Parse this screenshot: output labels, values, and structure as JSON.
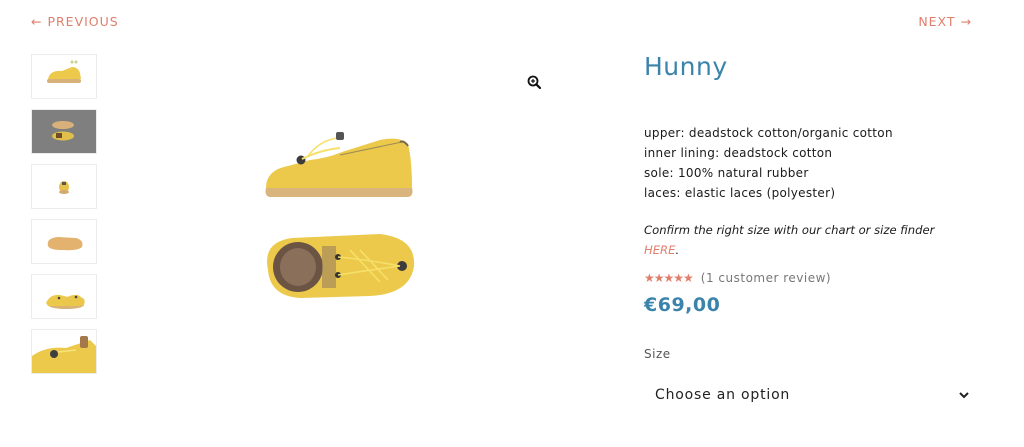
{
  "nav": {
    "previous_label": "← PREVIOUS",
    "next_label": "NEXT →"
  },
  "gallery": {
    "thumbnails": [
      "shoe-side-view",
      "shoe-pair-grey-background",
      "shoe-back-view",
      "shoe-sole-view",
      "shoe-pair-angle",
      "shoe-closeup"
    ]
  },
  "product": {
    "title": "Hunny",
    "specs": [
      "upper: deadstock cotton/organic cotton",
      "inner lining: deadstock cotton",
      "sole: 100% natural rubber",
      "laces: elastic laces (polyester)"
    ],
    "size_note_text": "Confirm the right size with our chart or size finder",
    "size_note_link": "HERE",
    "size_note_end": ".",
    "stars": "★★★★★",
    "rating": 5,
    "review_text": "(1 customer review)",
    "price": "€69,00",
    "size_label": "Size",
    "size_select_value": "Choose an option"
  },
  "colors": {
    "accent": "#3a83ab",
    "link": "#e07e6c",
    "shoe_yellow": "#ecc94a",
    "sole": "#d8b07a"
  }
}
